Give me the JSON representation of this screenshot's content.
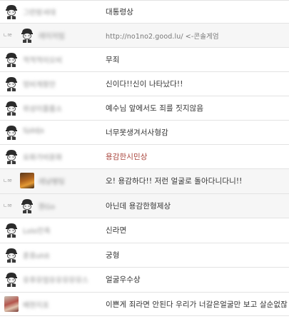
{
  "comments": [
    {
      "nickname": "그런랑셔대",
      "text": "대통령상",
      "reply": false,
      "avatar": "default"
    },
    {
      "nickname": "레이저빔",
      "text": "http://no1no2.good.lu/ <-콘솔게엄",
      "reply": true,
      "avatar": "default"
    },
    {
      "nickname": "꺽꺽꺽이오비",
      "text": "무죄",
      "reply": false,
      "avatar": "default"
    },
    {
      "nickname": "멍비게팡안",
      "text": "신이다!!신이 나타났다!!",
      "reply": false,
      "avatar": "default"
    },
    {
      "nickname": "위성이플룸소",
      "text": "예수님 앞에서도 죄를 짓지않음",
      "reply": false,
      "avatar": "default"
    },
    {
      "nickname": "Sjddjs",
      "text": "너무못생겨서사형감",
      "reply": false,
      "avatar": "default"
    },
    {
      "nickname": "요화가비윤화",
      "text": "용감한시민상",
      "reply": false,
      "avatar": "default",
      "highlight": true
    },
    {
      "nickname": "레냥팽팅",
      "text": "오! 용감하다!! 저런 얼굴로 돌아다니다니!!",
      "reply": true,
      "avatar": "photo"
    },
    {
      "nickname": "뭔Go",
      "text": "아닌데 용감한형제상",
      "reply": true,
      "avatar": "default"
    },
    {
      "nickname": "Lolo민축",
      "text": "신라면",
      "reply": false,
      "avatar": "default"
    },
    {
      "nickname": "훈휴ohlt",
      "text": "궁형",
      "reply": false,
      "avatar": "default"
    },
    {
      "nickname": "유후뮤멈유유뮤뮤뮤스",
      "text": "얼굴우수상",
      "reply": false,
      "avatar": "default"
    },
    {
      "nickname": "배현지포",
      "text": "이쁜게 죄라면 안된다 우리가 너갈은얼굴만 보고 살순없잖",
      "reply": false,
      "avatar": "photo2"
    }
  ],
  "reply_marker": "ㄴre",
  "colors": {
    "highlight_text": "#a8433a",
    "row_divider": "#e3e3e3",
    "reply_bg": "#f6f6f6"
  },
  "icons": {
    "default_avatar": "default-avatar-icon"
  }
}
